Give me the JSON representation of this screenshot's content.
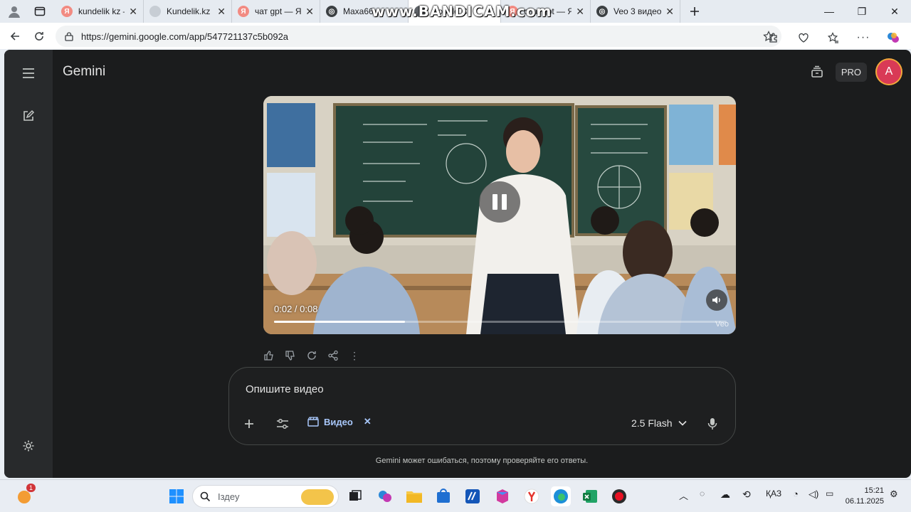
{
  "browser": {
    "tabs": [
      {
        "title": "kundelik kz —",
        "favicon": "yandex-icon",
        "color": "#f28b82",
        "active": false
      },
      {
        "title": "Kundelik.kz",
        "favicon": "kundelik-icon",
        "color": "#c7cdd4",
        "active": false
      },
      {
        "title": "чат gpt — Ян",
        "favicon": "yandex-icon",
        "color": "#f28b82",
        "active": false
      },
      {
        "title": "Maxa66",
        "favicon": "chatgpt-icon",
        "color": "#3c4043",
        "active": false
      },
      {
        "title": "Google C",
        "favicon": "google-icon",
        "color": "#5f6368",
        "active": true
      },
      {
        "title": "chat gpt — Я",
        "favicon": "yandex-icon",
        "color": "#f28b82",
        "active": false
      },
      {
        "title": "Veo 3 видео",
        "favicon": "chatgpt-icon",
        "color": "#3c4043",
        "active": false
      }
    ],
    "watermark": "www.BANDICAM.com",
    "url": "https://gemini.google.com/app/547721137c5b092a"
  },
  "gemini": {
    "brand": "Gemini",
    "pro_badge": "PRO",
    "avatar_letter": "A",
    "video": {
      "time": "0:02 / 0:08",
      "progress": 0.29,
      "watermark": "Veo"
    },
    "composer": {
      "prompt": "Опишите видео",
      "chip_label": "Видео",
      "model": "2.5 Flash"
    },
    "disclaimer": "Gemini может ошибаться, поэтому проверяйте его ответы."
  },
  "taskbar": {
    "notification_count": "1",
    "search_placeholder": "Іздеу",
    "language": "ҚАЗ",
    "time": "15:21",
    "date": "06.11.2025"
  },
  "colors": {
    "app_bg": "#1b1c1d",
    "sidebar_bg": "#282a2c",
    "accent_chip": "#a8c7fa",
    "avatar": "#d93a56"
  }
}
